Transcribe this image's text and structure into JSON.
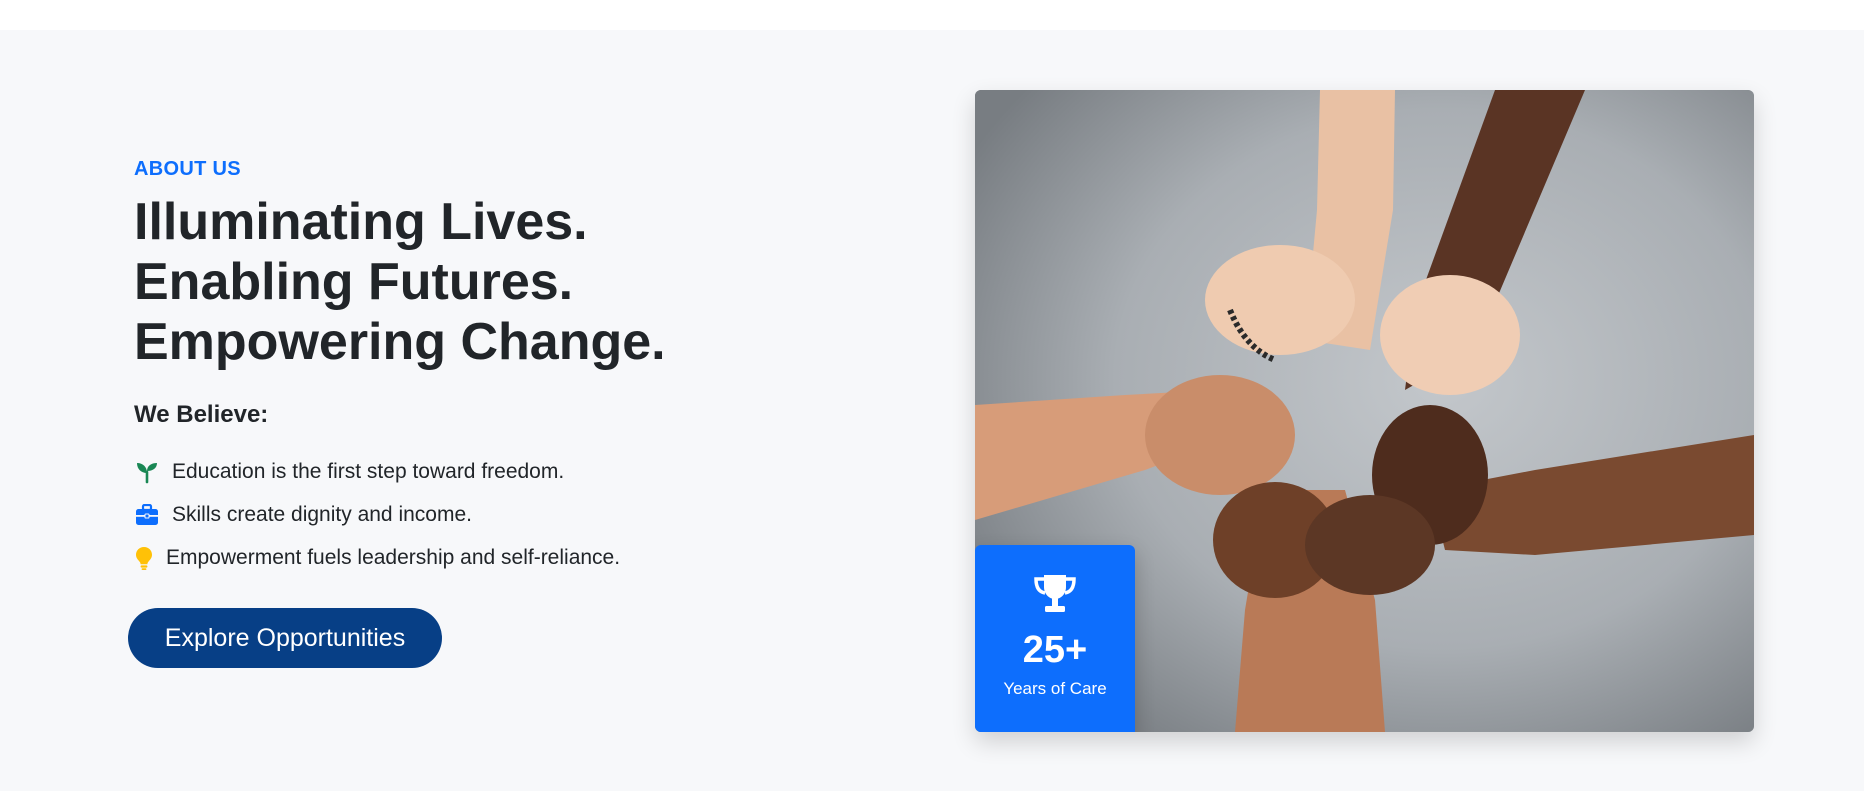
{
  "about": {
    "eyebrow": "ABOUT US",
    "heading_lines": [
      "Illuminating Lives.",
      "Enabling Futures.",
      "Empowering Change."
    ],
    "subheading": "We Believe:",
    "beliefs": [
      {
        "icon": "seedling-icon",
        "color": "#198754",
        "text": "Education is the first step toward freedom."
      },
      {
        "icon": "briefcase-icon",
        "color": "#0d6efd",
        "text": "Skills create dignity and income."
      },
      {
        "icon": "lightbulb-icon",
        "color": "#ffc107",
        "text": "Empowerment fuels leadership and self-reliance."
      }
    ],
    "cta_label": "Explore Opportunities"
  },
  "media": {
    "image": "linked-hands-photo",
    "stat": {
      "icon": "trophy-icon",
      "value": "25+",
      "label": "Years of Care"
    }
  },
  "colors": {
    "accent": "#0d6efd",
    "button": "#073f86",
    "heading": "#212529",
    "section_bg": "#f7f8fa"
  }
}
